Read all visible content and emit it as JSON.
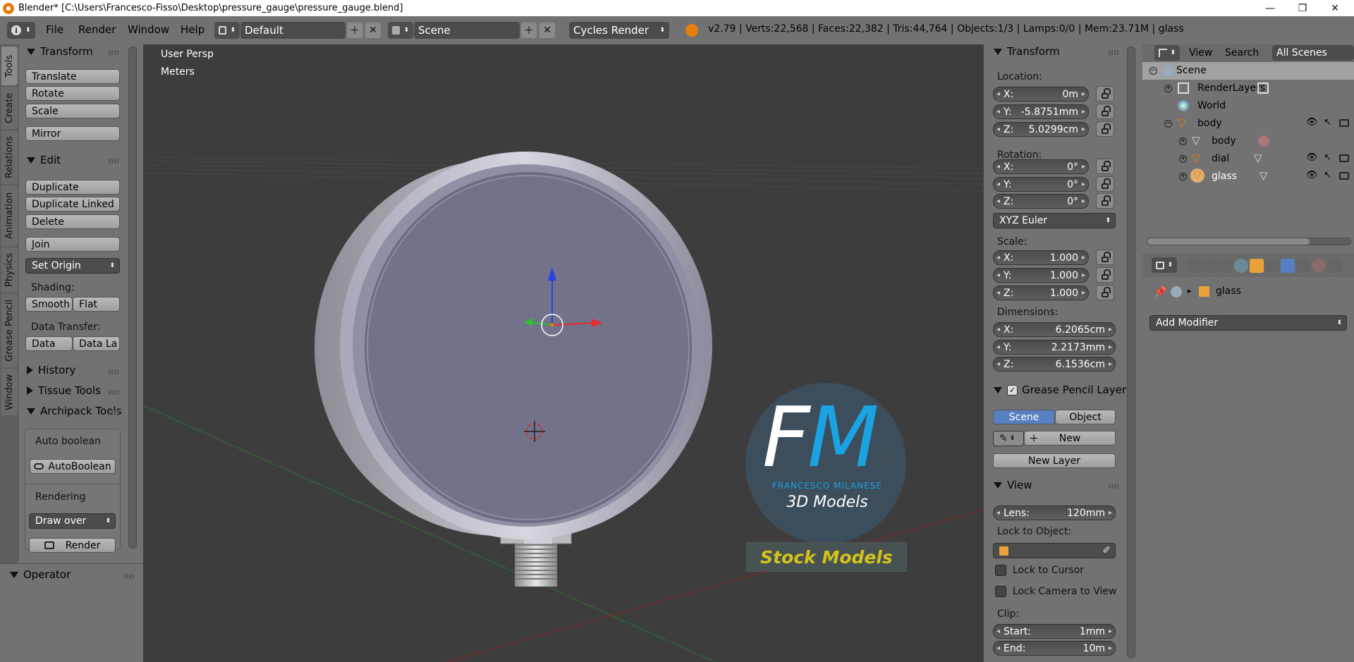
{
  "window": {
    "title": "Blender* [C:\\Users\\Francesco-Fisso\\Desktop\\pressure_gauge\\pressure_gauge.blend]",
    "minimize": "—",
    "maximize": "❐",
    "close": "✕"
  },
  "menubar": {
    "menus": [
      "File",
      "Render",
      "Window",
      "Help"
    ],
    "screen_layout": "Default",
    "scene": "Scene",
    "render_engine": "Cycles Render",
    "stats": "v2.79 | Verts:22,568 | Faces:22,382 | Tris:44,764 | Objects:1/3 | Lamps:0/0 | Mem:23.71M | glass"
  },
  "tool_tabs": [
    "Tools",
    "Create",
    "Relations",
    "Animation",
    "Physics",
    "Grease Pencil",
    "Window"
  ],
  "toolshelf": {
    "transform": {
      "title": "Transform",
      "buttons": [
        "Translate",
        "Rotate",
        "Scale",
        "Mirror"
      ]
    },
    "edit": {
      "title": "Edit",
      "buttons": [
        "Duplicate",
        "Duplicate Linked",
        "Delete",
        "Join"
      ],
      "set_origin": "Set Origin",
      "shading_label": "Shading:",
      "smooth": "Smooth",
      "flat": "Flat",
      "data_transfer_label": "Data Transfer:",
      "data": "Data",
      "data_la": "Data La"
    },
    "history": "History",
    "tissue_tools": "Tissue Tools",
    "archipack": {
      "title": "Archipack Tools",
      "auto_boolean_label": "Auto boolean",
      "autoboolean_btn": "AutoBoolean",
      "rendering_label": "Rendering",
      "draw_over": "Draw over",
      "render_btn": "Render"
    },
    "operator": "Operator"
  },
  "viewport": {
    "view_name": "User Persp",
    "units": "Meters",
    "watermark": {
      "initials_f": "F",
      "initials_m": "M",
      "name": "FRANCESCO MILANESE",
      "sub": "3D Models",
      "banner": "Stock Models"
    }
  },
  "npanel": {
    "transform_title": "Transform",
    "location_label": "Location:",
    "location": [
      {
        "axis": "X:",
        "value": "0m"
      },
      {
        "axis": "Y:",
        "value": "-5.8751mm"
      },
      {
        "axis": "Z:",
        "value": "5.0299cm"
      }
    ],
    "rotation_label": "Rotation:",
    "rotation": [
      {
        "axis": "X:",
        "value": "0°"
      },
      {
        "axis": "Y:",
        "value": "0°"
      },
      {
        "axis": "Z:",
        "value": "0°"
      }
    ],
    "rotation_mode": "XYZ Euler",
    "scale_label": "Scale:",
    "scale": [
      {
        "axis": "X:",
        "value": "1.000"
      },
      {
        "axis": "Y:",
        "value": "1.000"
      },
      {
        "axis": "Z:",
        "value": "1.000"
      }
    ],
    "dimensions_label": "Dimensions:",
    "dimensions": [
      {
        "axis": "X:",
        "value": "6.2065cm"
      },
      {
        "axis": "Y:",
        "value": "2.2173mm"
      },
      {
        "axis": "Z:",
        "value": "6.1536cm"
      }
    ],
    "grease_title": "Grease Pencil Layer",
    "scene_btn": "Scene",
    "object_btn": "Object",
    "new_btn": "New",
    "new_layer_btn": "New Layer",
    "view_title": "View",
    "lens_label": "Lens:",
    "lens_value": "120mm",
    "lock_object_label": "Lock to Object:",
    "lock_cursor": "Lock to Cursor",
    "lock_camera": "Lock Camera to View",
    "clip_label": "Clip:",
    "clip_start_label": "Start:",
    "clip_start": "1mm",
    "clip_end_label": "End:",
    "clip_end": "10m"
  },
  "outliner": {
    "view": "View",
    "search": "Search",
    "filter": "All Scenes",
    "rows": [
      "Scene",
      "RenderLayers",
      "World",
      "body",
      "body",
      "dial",
      "glass"
    ]
  },
  "properties": {
    "object_name": "glass",
    "add_modifier": "Add Modifier"
  },
  "colors": {
    "accent": "#5680c2",
    "blender_orange": "#e87d0d",
    "fm_blue": "#1aa3e0",
    "stock_yellow": "#d4c31a"
  }
}
